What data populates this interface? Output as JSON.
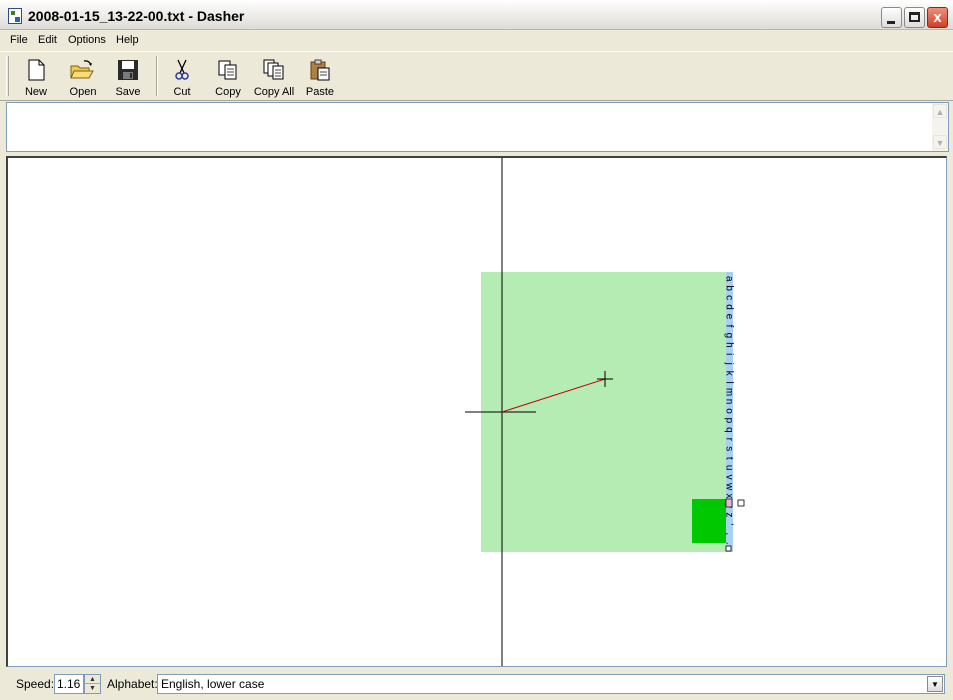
{
  "window": {
    "title": "2008-01-15_13-22-00.txt - Dasher",
    "close_glyph": "x"
  },
  "menu": [
    "File",
    "Edit",
    "Options",
    "Help"
  ],
  "toolbar": {
    "buttons": [
      {
        "label": "New",
        "icon": "new-document-icon"
      },
      {
        "label": "Open",
        "icon": "open-folder-icon"
      },
      {
        "label": "Save",
        "icon": "floppy-disk-icon"
      },
      {
        "label": "Cut",
        "icon": "scissors-icon"
      },
      {
        "label": "Copy",
        "icon": "copy-icon"
      },
      {
        "label": "Copy All",
        "icon": "copy-all-icon"
      },
      {
        "label": "Paste",
        "icon": "clipboard-paste-icon"
      }
    ]
  },
  "text_area": {
    "value": ""
  },
  "dasher": {
    "letters": [
      "a",
      "b",
      "c",
      "d",
      "e",
      "f",
      "g",
      "h",
      "i",
      "j",
      "k",
      "l",
      "m",
      "n",
      "o",
      "p",
      "q",
      "r",
      "s",
      "t",
      "u",
      "v",
      "w",
      "x",
      "y",
      "z",
      "'",
      ",",
      "."
    ],
    "colors": {
      "main_box": "#b4ecb4",
      "child_box": "#00c800",
      "letter_col": "#a8d0f0",
      "pointer_line": "#cc0000",
      "crosshair": "#000000"
    }
  },
  "statusbar": {
    "speed_label": "Speed:",
    "speed_value": "1.16",
    "alphabet_label": "Alphabet:",
    "alphabet_value": "English, lower case"
  }
}
